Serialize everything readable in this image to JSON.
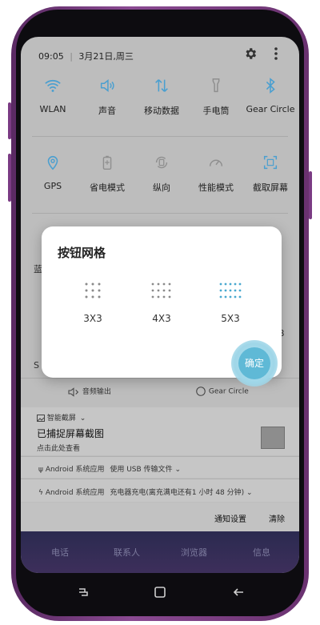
{
  "status": {
    "time": "09:05",
    "date": "3月21日,周三"
  },
  "tiles_row1": [
    "WLAN",
    "声音",
    "移动数据",
    "手电筒",
    "Gear Circle"
  ],
  "tiles_row2": [
    "GPS",
    "省电模式",
    "纵向",
    "性能模式",
    "截取屏幕"
  ],
  "dialog": {
    "title": "按钮网格",
    "options": [
      "3X3",
      "4X3",
      "5X3"
    ],
    "confirm": "确定"
  },
  "peek": {
    "left_char": "蓝",
    "left_char2": "S",
    "right_char": "B"
  },
  "audio": {
    "output": "音频输出",
    "gear_circle": "Gear Circle"
  },
  "notifications": {
    "smart_capture": "智能截屏",
    "captured_title": "已捕捉屏幕截图",
    "captured_sub": "点击此处查看",
    "usb_app": "Android 系统应用",
    "usb_text": "使用 USB 传输文件",
    "charge_app": "Android 系统应用",
    "charge_text": "充电器充电(离充满电还有1 小时 48 分钟)",
    "settings": "通知设置",
    "clear": "清除"
  },
  "dock": [
    "电话",
    "联系人",
    "浏览器",
    "信息"
  ],
  "colors": {
    "accent": "#5fb9d6",
    "tile_icon": "#4a9fd0",
    "dock_bg": "#2b2a50"
  }
}
